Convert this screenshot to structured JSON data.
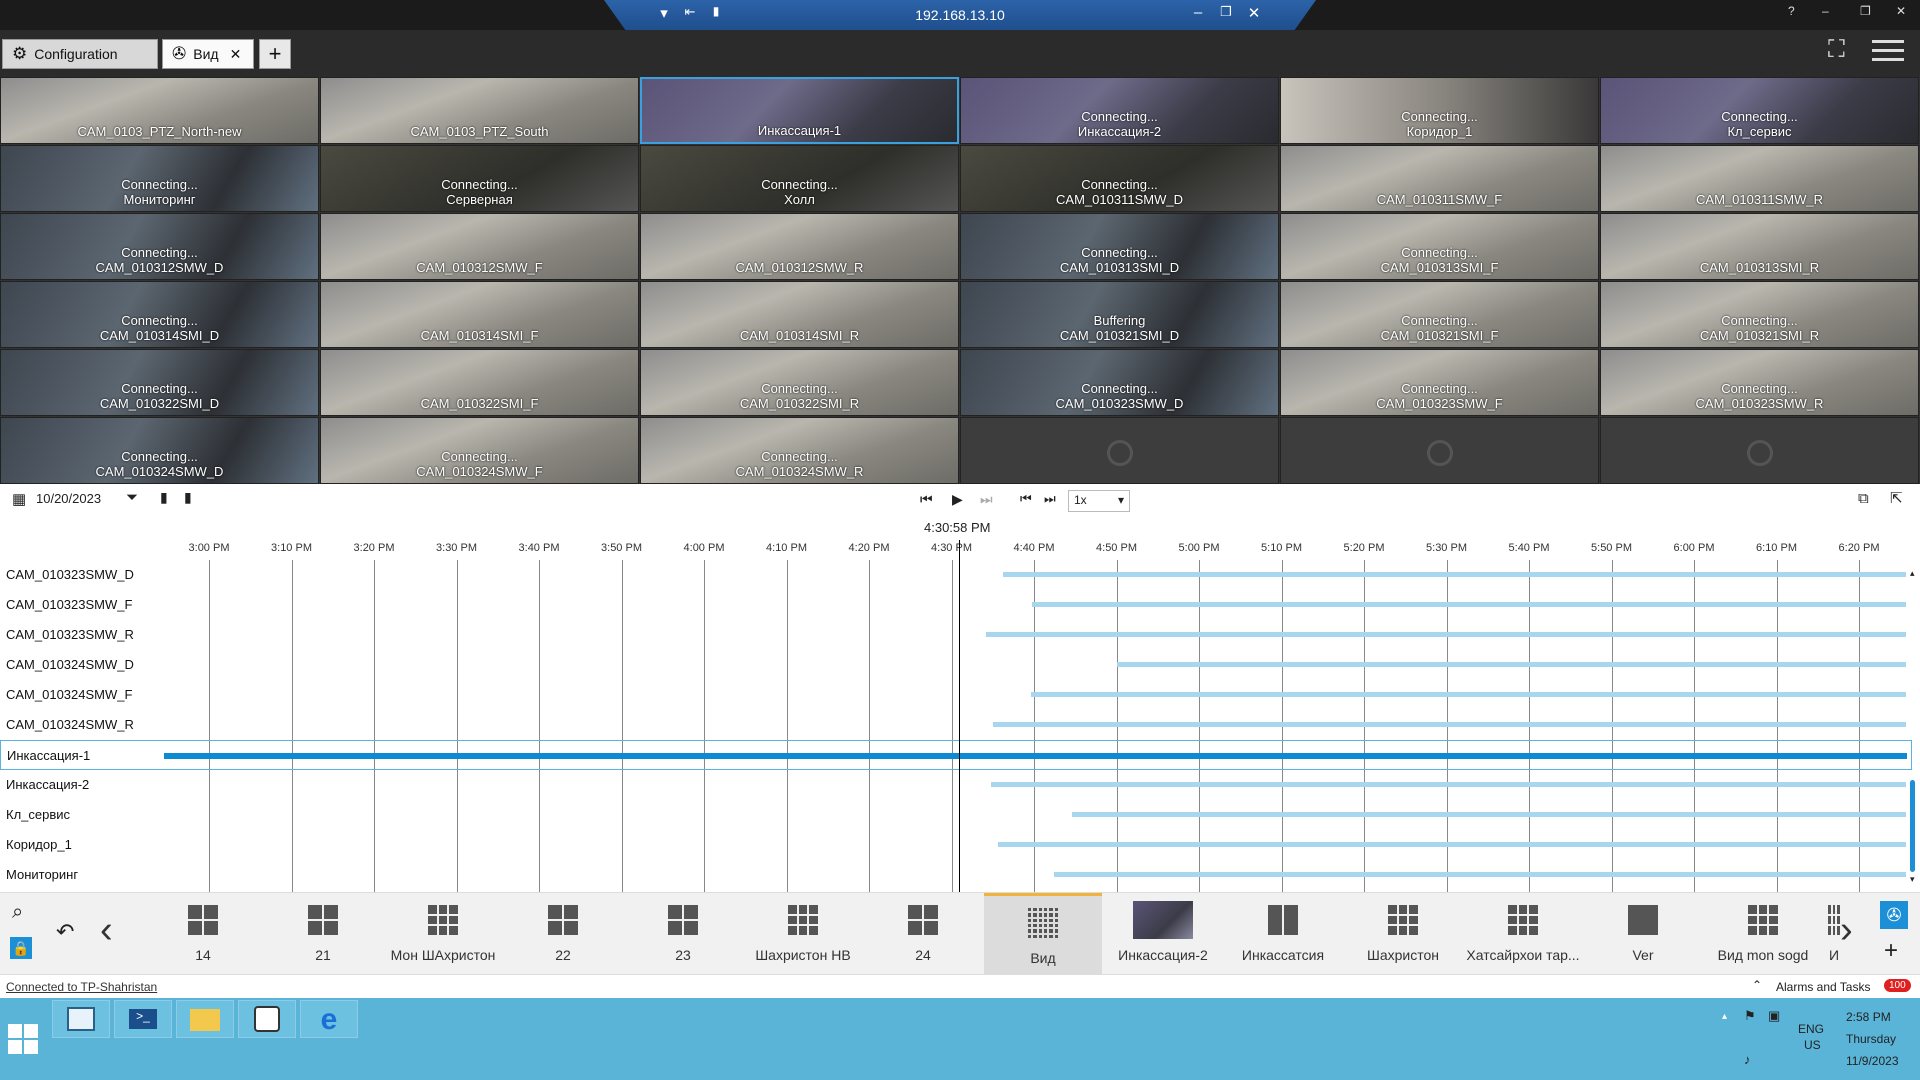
{
  "titlebar": {
    "ip": "192.168.13.10",
    "help": "?"
  },
  "tabs": {
    "config": "Configuration",
    "view": "Вид"
  },
  "cameras": [
    {
      "status": "",
      "name": "CAM_0103_PTZ_North-new",
      "img": "road"
    },
    {
      "status": "",
      "name": "CAM_0103_PTZ_South",
      "img": "road"
    },
    {
      "status": "",
      "name": "Инкассация-1",
      "img": "office"
    },
    {
      "status": "Connecting...",
      "name": "Инкассация-2",
      "img": "office"
    },
    {
      "status": "Connecting...",
      "name": "Коридор_1",
      "img": "corridor"
    },
    {
      "status": "Connecting...",
      "name": "Кл_сервис",
      "img": "office"
    },
    {
      "status": "Connecting...",
      "name": "Мониторинг",
      "img": "person"
    },
    {
      "status": "Connecting...",
      "name": "Серверная",
      "img": "dark"
    },
    {
      "status": "Connecting...",
      "name": "Холл",
      "img": "dark"
    },
    {
      "status": "Connecting...",
      "name": "CAM_010311SMW_D",
      "img": "dark"
    },
    {
      "status": "",
      "name": "CAM_010311SMW_F",
      "img": "road"
    },
    {
      "status": "",
      "name": "CAM_010311SMW_R",
      "img": "road"
    },
    {
      "status": "Connecting...",
      "name": "CAM_010312SMW_D",
      "img": "person"
    },
    {
      "status": "",
      "name": "CAM_010312SMW_F",
      "img": "road"
    },
    {
      "status": "",
      "name": "CAM_010312SMW_R",
      "img": "road"
    },
    {
      "status": "Connecting...",
      "name": "CAM_010313SMI_D",
      "img": "person"
    },
    {
      "status": "Connecting...",
      "name": "CAM_010313SMI_F",
      "img": "road"
    },
    {
      "status": "",
      "name": "CAM_010313SMI_R",
      "img": "road"
    },
    {
      "status": "Connecting...",
      "name": "CAM_010314SMI_D",
      "img": "person"
    },
    {
      "status": "",
      "name": "CAM_010314SMI_F",
      "img": "road"
    },
    {
      "status": "",
      "name": "CAM_010314SMI_R",
      "img": "road"
    },
    {
      "status": "Buffering",
      "name": "CAM_010321SMI_D",
      "img": "person"
    },
    {
      "status": "Connecting...",
      "name": "CAM_010321SMI_F",
      "img": "road"
    },
    {
      "status": "Connecting...",
      "name": "CAM_010321SMI_R",
      "img": "road"
    },
    {
      "status": "Connecting...",
      "name": "CAM_010322SMI_D",
      "img": "person"
    },
    {
      "status": "",
      "name": "CAM_010322SMI_F",
      "img": "road"
    },
    {
      "status": "Connecting...",
      "name": "CAM_010322SMI_R",
      "img": "road"
    },
    {
      "status": "Connecting...",
      "name": "CAM_010323SMW_D",
      "img": "person"
    },
    {
      "status": "Connecting...",
      "name": "CAM_010323SMW_F",
      "img": "road"
    },
    {
      "status": "Connecting...",
      "name": "CAM_010323SMW_R",
      "img": "road"
    },
    {
      "status": "Connecting...",
      "name": "CAM_010324SMW_D",
      "img": "person"
    },
    {
      "status": "Connecting...",
      "name": "CAM_010324SMW_F",
      "img": "road"
    },
    {
      "status": "Connecting...",
      "name": "CAM_010324SMW_R",
      "img": "road"
    },
    {
      "status": "",
      "name": "",
      "img": "empty"
    },
    {
      "status": "",
      "name": "",
      "img": "empty"
    },
    {
      "status": "",
      "name": "",
      "img": "empty"
    }
  ],
  "controls": {
    "date": "10/20/2023",
    "speed": "1x",
    "cursor_time": "4:30:58 PM"
  },
  "timeline": {
    "ticks": [
      "3:00 PM",
      "3:10 PM",
      "3:20 PM",
      "3:30 PM",
      "3:40 PM",
      "3:50 PM",
      "4:00 PM",
      "4:10 PM",
      "4:20 PM",
      "4:30 PM",
      "4:40 PM",
      "4:50 PM",
      "5:00 PM",
      "5:10 PM",
      "5:20 PM",
      "5:30 PM",
      "5:40 PM",
      "5:50 PM",
      "6:00 PM",
      "6:10 PM",
      "6:20 PM"
    ],
    "rows": [
      {
        "name": "CAM_010323SMW_D",
        "start_min": 16.2,
        "selected": false
      },
      {
        "name": "CAM_010323SMW_F",
        "start_min": 19.8,
        "selected": false
      },
      {
        "name": "CAM_010323SMW_R",
        "start_min": 14.2,
        "selected": false
      },
      {
        "name": "CAM_010324SMW_D",
        "start_min": 30.0,
        "selected": false
      },
      {
        "name": "CAM_010324SMW_F",
        "start_min": 19.6,
        "selected": false
      },
      {
        "name": "CAM_010324SMW_R",
        "start_min": 15.0,
        "selected": false
      },
      {
        "name": "Инкассация-1",
        "start_min": -110.0,
        "selected": true
      },
      {
        "name": "Инкассация-2",
        "start_min": 14.8,
        "selected": false
      },
      {
        "name": "Кл_сервис",
        "start_min": 24.6,
        "selected": false
      },
      {
        "name": "Коридор_1",
        "start_min": 15.6,
        "selected": false
      },
      {
        "name": "Мониторинг",
        "start_min": 22.4,
        "selected": false
      }
    ]
  },
  "views": [
    {
      "label": "14",
      "icon": "grid-2x2",
      "active": false
    },
    {
      "label": "21",
      "icon": "grid-2x2",
      "active": false
    },
    {
      "label": "Мон ШАхристон",
      "icon": "grid-3x3",
      "active": false
    },
    {
      "label": "22",
      "icon": "grid-2x2",
      "active": false
    },
    {
      "label": "23",
      "icon": "grid-2x2",
      "active": false
    },
    {
      "label": "Шахристон НВ",
      "icon": "grid-3x3",
      "active": false
    },
    {
      "label": "24",
      "icon": "grid-2x2",
      "active": false
    },
    {
      "label": "Вид",
      "icon": "grid-6x6",
      "active": true
    },
    {
      "label": "Инкассация-2",
      "icon": "thumbnail",
      "active": false
    },
    {
      "label": "Инкассатсия",
      "icon": "grid-1x2",
      "active": false
    },
    {
      "label": "Шахристон",
      "icon": "grid-3x3",
      "active": false
    },
    {
      "label": "Хатсайрхои тар...",
      "icon": "grid-3x3",
      "active": false
    },
    {
      "label": "Ver",
      "icon": "grid-1x1",
      "active": false
    },
    {
      "label": "Вид mon sogd",
      "icon": "grid-3x3",
      "active": false
    },
    {
      "label": "И",
      "icon": "grid-3x3",
      "active": false
    }
  ],
  "status": {
    "connected": "Connected to TP-Shahristan",
    "alarms": "Alarms and Tasks",
    "alarm_count": "100"
  },
  "taskbar": {
    "lang1": "ENG",
    "lang2": "US",
    "time": "2:58 PM",
    "day": "Thursday",
    "date": "11/9/2023"
  },
  "colors": {
    "accent": "#0e8ad4",
    "bar_light": "#a8d6ee",
    "taskbar": "#5ab4d8",
    "active_view": "#f0b43c"
  }
}
